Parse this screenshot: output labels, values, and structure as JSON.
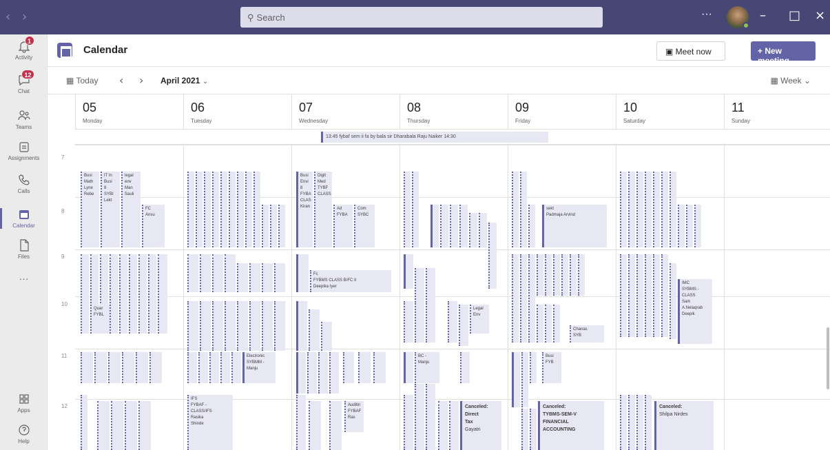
{
  "titlebar": {
    "search_placeholder": "Search",
    "more": "···"
  },
  "rail": [
    {
      "label": "Activity",
      "badge": "1"
    },
    {
      "label": "Chat",
      "badge": "12"
    },
    {
      "label": "Teams",
      "badge": ""
    },
    {
      "label": "Assignments",
      "badge": ""
    },
    {
      "label": "Calls",
      "badge": ""
    },
    {
      "label": "Calendar",
      "badge": ""
    },
    {
      "label": "Files",
      "badge": ""
    },
    {
      "label": "···",
      "badge": ""
    },
    {
      "label": "Apps",
      "badge": ""
    },
    {
      "label": "Help",
      "badge": ""
    }
  ],
  "header": {
    "title": "Calendar",
    "meet_now": "Meet now",
    "new_meeting": "New meeting"
  },
  "toolbar": {
    "today": "Today",
    "month": "April 2021",
    "view": "Week"
  },
  "days": [
    {
      "num": "05",
      "name": "Monday"
    },
    {
      "num": "06",
      "name": "Tuesday"
    },
    {
      "num": "07",
      "name": "Wednesday"
    },
    {
      "num": "08",
      "name": "Thursday"
    },
    {
      "num": "09",
      "name": "Friday"
    },
    {
      "num": "10",
      "name": "Saturday"
    },
    {
      "num": "11",
      "name": "Sunday"
    }
  ],
  "allday_event": "13:45 fybaf sem ii fa by bala sir  Dharabala Raju Naiker  14:30",
  "hours": [
    "7",
    "8",
    "9",
    "10",
    "11",
    "12"
  ],
  "events": {
    "e1": [
      "Busi",
      "Math",
      "Lyne",
      "Rebe"
    ],
    "e2": [
      "IT In",
      "Busi",
      "8",
      "SYBI",
      "Lekt"
    ],
    "e3": [
      "legal",
      "env",
      "Man",
      "Sauli"
    ],
    "e4": [
      "FC",
      "Ansu"
    ],
    "e5": [
      "Busi",
      "Envi",
      "8",
      "FYBA",
      "CLAS",
      "Kiran"
    ],
    "e6": [
      "Digit",
      "Med",
      "TYBF",
      "CLASS"
    ],
    "e7": [
      "Ad",
      "FYBA"
    ],
    "e8": [
      "Com",
      "SYBC"
    ],
    "e9": [
      "sekt",
      "Padmaja Arvind"
    ],
    "e10": [
      "Fc",
      "FYBMS CLASS B/FC II",
      "Deepika Iyer"
    ],
    "e11": [
      "Quar",
      "FYBL"
    ],
    "e12": [
      "Legal",
      "Env"
    ],
    "e13": [
      "IMC",
      "SYBMS -",
      "CLASS",
      "Sam",
      "A.Nelaqrab",
      "Deepik"
    ],
    "e14": [
      "Electronic",
      "SYBMM -",
      "Manju"
    ],
    "e15": [
      "BC -",
      "Manju"
    ],
    "e16": [
      "Busi",
      "FYB"
    ],
    "e17": [
      "Chanas",
      "SYB"
    ],
    "e18": [
      "IFS",
      "FYBAF -",
      "CLASS/IFS",
      "Rasika",
      "Shinde"
    ],
    "e19": [
      "Auditin",
      "FYBAF",
      "Ras"
    ],
    "e20": [
      "Canceled:",
      "Direct",
      "Tax",
      "Gayatri"
    ],
    "e21": [
      "Canceled:",
      "TYBMS-SEM-V",
      "FINANCIAL",
      "ACCOUNTING"
    ],
    "e22": [
      "Canceled:",
      "Shilpa Nirdes"
    ]
  }
}
